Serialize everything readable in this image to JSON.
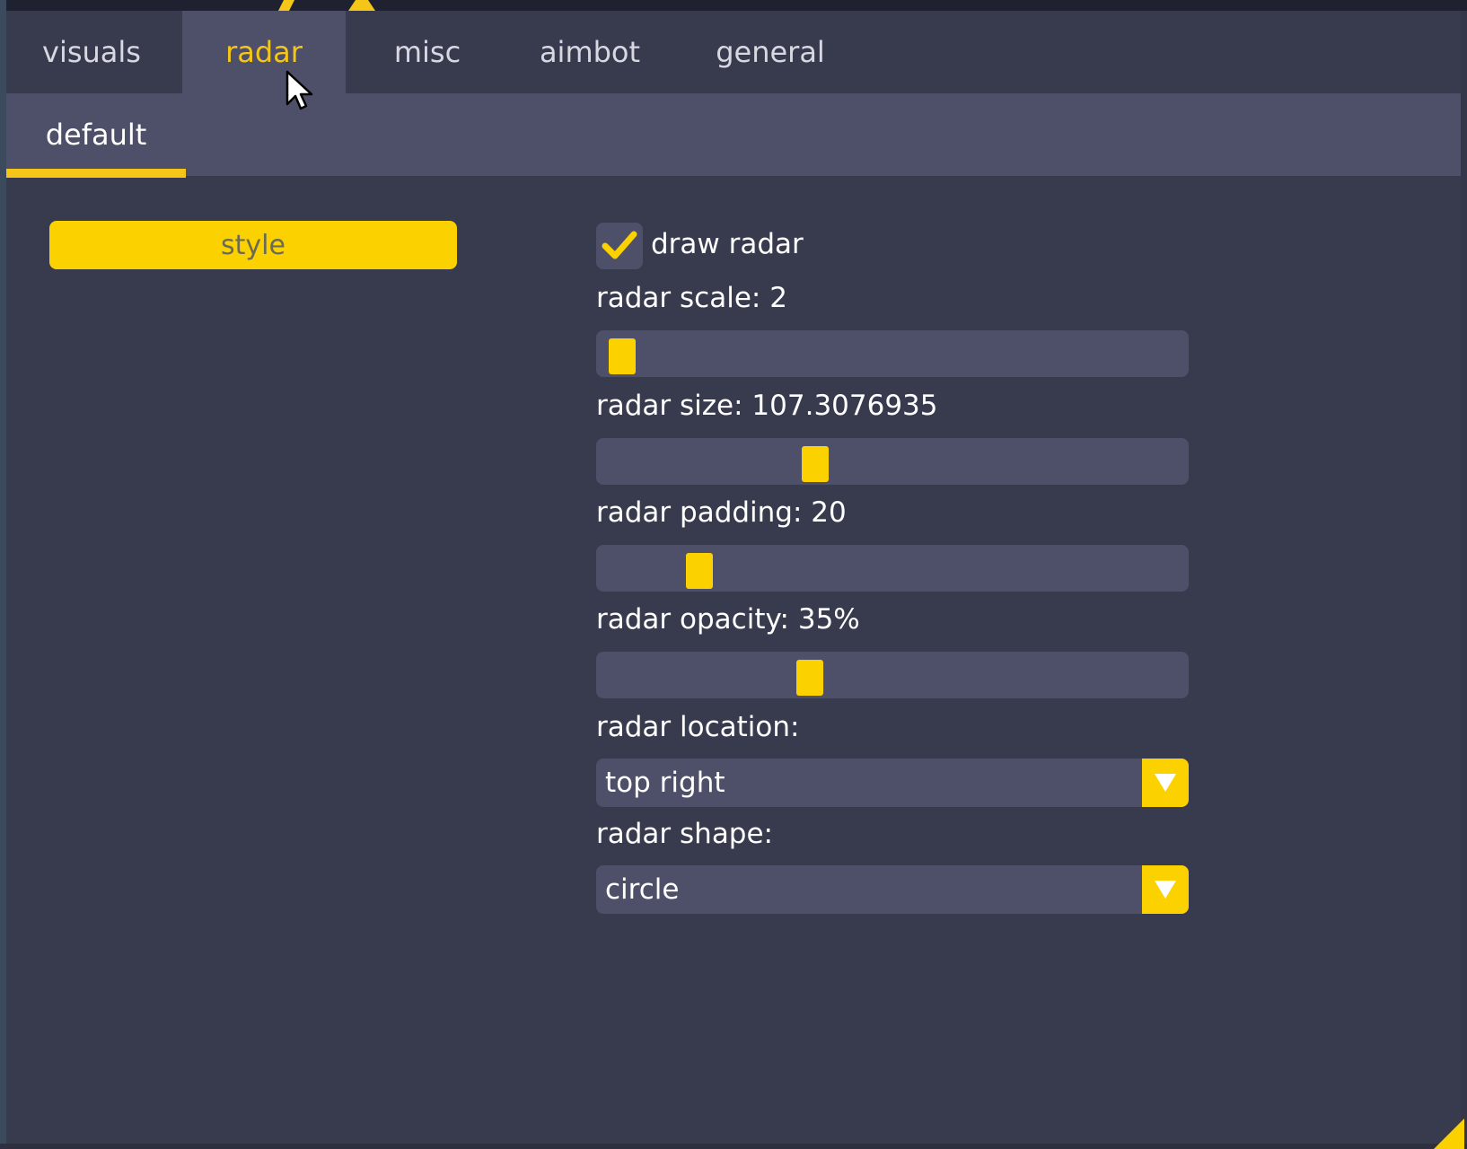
{
  "tabs": [
    {
      "label": "visuals",
      "active": false
    },
    {
      "label": "radar",
      "active": true
    },
    {
      "label": "misc",
      "active": false
    },
    {
      "label": "aimbot",
      "active": false
    },
    {
      "label": "general",
      "active": false
    }
  ],
  "subtabs": [
    {
      "label": "default",
      "active": true
    }
  ],
  "left_panel": {
    "style_button_label": "style"
  },
  "settings": {
    "draw_radar": {
      "label": "draw radar",
      "checked": true
    },
    "radar_scale": {
      "label": "radar scale: 2",
      "fraction": 0.01
    },
    "radar_size": {
      "label": "radar size: 107.3076935",
      "fraction": 0.36
    },
    "radar_padding": {
      "label": "radar padding: 20",
      "fraction": 0.15
    },
    "radar_opacity": {
      "label": "radar opacity: 35%",
      "fraction": 0.35
    },
    "radar_location": {
      "label": "radar location:",
      "value": "top right"
    },
    "radar_shape": {
      "label": "radar shape:",
      "value": "circle"
    }
  },
  "colors": {
    "accent": "#fbd100",
    "panel": "#383a4e",
    "control": "#4e5069",
    "text": "#ffffff"
  },
  "icons": {
    "checkbox": "check-icon",
    "dropdown": "triangle-down-icon",
    "cursor": "arrow-cursor-icon",
    "resize": "resize-grip-icon"
  }
}
